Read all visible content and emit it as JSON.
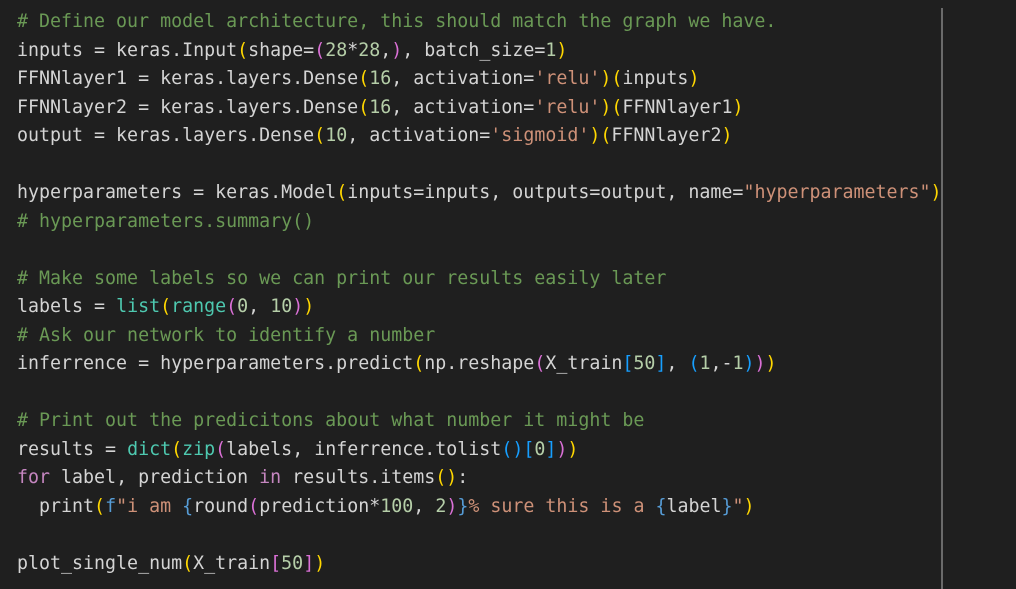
{
  "palette": {
    "background": "#1f1f1f",
    "comment": "#6a9955",
    "identifier": "#d4d4d4",
    "string": "#ce9178",
    "number": "#b5cea8",
    "builtin": "#4ec9b0",
    "keyword": "#c586c0",
    "brace_level_1": "#ffd700",
    "brace_level_2": "#da70d6",
    "brace_level_3": "#179fff",
    "fstring_prefix": "#569cd6"
  },
  "lines": [
    [
      {
        "t": "comment",
        "v": "# Define our model architecture, this should match the graph we have."
      }
    ],
    [
      {
        "t": "ident",
        "v": "inputs = keras.Input"
      },
      {
        "t": "brace1",
        "v": "("
      },
      {
        "t": "ident",
        "v": "shape="
      },
      {
        "t": "brace2",
        "v": "("
      },
      {
        "t": "number",
        "v": "28"
      },
      {
        "t": "op",
        "v": "*"
      },
      {
        "t": "number",
        "v": "28"
      },
      {
        "t": "op",
        "v": ","
      },
      {
        "t": "brace2",
        "v": ")"
      },
      {
        "t": "op",
        "v": ", batch_size="
      },
      {
        "t": "number",
        "v": "1"
      },
      {
        "t": "brace1",
        "v": ")"
      }
    ],
    [
      {
        "t": "ident",
        "v": "FFNNlayer1 = keras.layers.Dense"
      },
      {
        "t": "brace1",
        "v": "("
      },
      {
        "t": "number",
        "v": "16"
      },
      {
        "t": "op",
        "v": ", activation="
      },
      {
        "t": "string",
        "v": "'relu'"
      },
      {
        "t": "brace1",
        "v": ")"
      },
      {
        "t": "brace1",
        "v": "("
      },
      {
        "t": "ident",
        "v": "inputs"
      },
      {
        "t": "brace1",
        "v": ")"
      }
    ],
    [
      {
        "t": "ident",
        "v": "FFNNlayer2 = keras.layers.Dense"
      },
      {
        "t": "brace1",
        "v": "("
      },
      {
        "t": "number",
        "v": "16"
      },
      {
        "t": "op",
        "v": ", activation="
      },
      {
        "t": "string",
        "v": "'relu'"
      },
      {
        "t": "brace1",
        "v": ")"
      },
      {
        "t": "brace1",
        "v": "("
      },
      {
        "t": "ident",
        "v": "FFNNlayer1"
      },
      {
        "t": "brace1",
        "v": ")"
      }
    ],
    [
      {
        "t": "ident",
        "v": "output = keras.layers.Dense"
      },
      {
        "t": "brace1",
        "v": "("
      },
      {
        "t": "number",
        "v": "10"
      },
      {
        "t": "op",
        "v": ", activation="
      },
      {
        "t": "string",
        "v": "'sigmoid'"
      },
      {
        "t": "brace1",
        "v": ")"
      },
      {
        "t": "brace1",
        "v": "("
      },
      {
        "t": "ident",
        "v": "FFNNlayer2"
      },
      {
        "t": "brace1",
        "v": ")"
      }
    ],
    [],
    [
      {
        "t": "ident",
        "v": "hyperparameters = keras.Model"
      },
      {
        "t": "brace1",
        "v": "("
      },
      {
        "t": "ident",
        "v": "inputs=inputs, outputs=output, name="
      },
      {
        "t": "string",
        "v": "\"hyperparameters\""
      },
      {
        "t": "brace1",
        "v": ")"
      }
    ],
    [
      {
        "t": "comment",
        "v": "# hyperparameters.summary()"
      }
    ],
    [],
    [
      {
        "t": "comment",
        "v": "# Make some labels so we can print our results easily later"
      }
    ],
    [
      {
        "t": "ident",
        "v": "labels = "
      },
      {
        "t": "builtin",
        "v": "list"
      },
      {
        "t": "brace1",
        "v": "("
      },
      {
        "t": "builtin",
        "v": "range"
      },
      {
        "t": "brace2",
        "v": "("
      },
      {
        "t": "number",
        "v": "0"
      },
      {
        "t": "op",
        "v": ", "
      },
      {
        "t": "number",
        "v": "10"
      },
      {
        "t": "brace2",
        "v": ")"
      },
      {
        "t": "brace1",
        "v": ")"
      }
    ],
    [
      {
        "t": "comment",
        "v": "# Ask our network to identify a number"
      }
    ],
    [
      {
        "t": "ident",
        "v": "inferrence = hyperparameters.predict"
      },
      {
        "t": "brace1",
        "v": "("
      },
      {
        "t": "ident",
        "v": "np.reshape"
      },
      {
        "t": "brace2",
        "v": "("
      },
      {
        "t": "ident",
        "v": "X_train"
      },
      {
        "t": "brace3",
        "v": "["
      },
      {
        "t": "number",
        "v": "50"
      },
      {
        "t": "brace3",
        "v": "]"
      },
      {
        "t": "op",
        "v": ", "
      },
      {
        "t": "brace3",
        "v": "("
      },
      {
        "t": "number",
        "v": "1"
      },
      {
        "t": "op",
        "v": ",-"
      },
      {
        "t": "number",
        "v": "1"
      },
      {
        "t": "brace3",
        "v": ")"
      },
      {
        "t": "brace2",
        "v": ")"
      },
      {
        "t": "brace1",
        "v": ")"
      }
    ],
    [],
    [
      {
        "t": "comment",
        "v": "# Print out the predicitons about what number it might be"
      }
    ],
    [
      {
        "t": "ident",
        "v": "results = "
      },
      {
        "t": "builtin",
        "v": "dict"
      },
      {
        "t": "brace1",
        "v": "("
      },
      {
        "t": "builtin",
        "v": "zip"
      },
      {
        "t": "brace2",
        "v": "("
      },
      {
        "t": "ident",
        "v": "labels, inferrence.tolist"
      },
      {
        "t": "brace3",
        "v": "()"
      },
      {
        "t": "brace3",
        "v": "["
      },
      {
        "t": "number",
        "v": "0"
      },
      {
        "t": "brace3",
        "v": "]"
      },
      {
        "t": "brace2",
        "v": ")"
      },
      {
        "t": "brace1",
        "v": ")"
      }
    ],
    [
      {
        "t": "keyword",
        "v": "for"
      },
      {
        "t": "ident",
        "v": " label, prediction "
      },
      {
        "t": "keyword",
        "v": "in"
      },
      {
        "t": "ident",
        "v": " results.items"
      },
      {
        "t": "brace1",
        "v": "()"
      },
      {
        "t": "op",
        "v": ":"
      }
    ],
    [
      {
        "t": "ident",
        "v": "  print"
      },
      {
        "t": "brace1",
        "v": "("
      },
      {
        "t": "fstr",
        "v": "f"
      },
      {
        "t": "string",
        "v": "\"i am "
      },
      {
        "t": "fstr",
        "v": "{"
      },
      {
        "t": "ident",
        "v": "round"
      },
      {
        "t": "brace2",
        "v": "("
      },
      {
        "t": "ident",
        "v": "prediction*"
      },
      {
        "t": "number",
        "v": "100"
      },
      {
        "t": "op",
        "v": ", "
      },
      {
        "t": "number",
        "v": "2"
      },
      {
        "t": "brace2",
        "v": ")"
      },
      {
        "t": "fstr",
        "v": "}"
      },
      {
        "t": "string",
        "v": "% sure this is a "
      },
      {
        "t": "fstr",
        "v": "{"
      },
      {
        "t": "ident",
        "v": "label"
      },
      {
        "t": "fstr",
        "v": "}"
      },
      {
        "t": "string",
        "v": "\""
      },
      {
        "t": "brace1",
        "v": ")"
      }
    ],
    [],
    [
      {
        "t": "ident",
        "v": "plot_single_num"
      },
      {
        "t": "brace1",
        "v": "("
      },
      {
        "t": "ident",
        "v": "X_train"
      },
      {
        "t": "brace2",
        "v": "["
      },
      {
        "t": "number",
        "v": "50"
      },
      {
        "t": "brace2",
        "v": "]"
      },
      {
        "t": "brace1",
        "v": ")"
      }
    ]
  ]
}
